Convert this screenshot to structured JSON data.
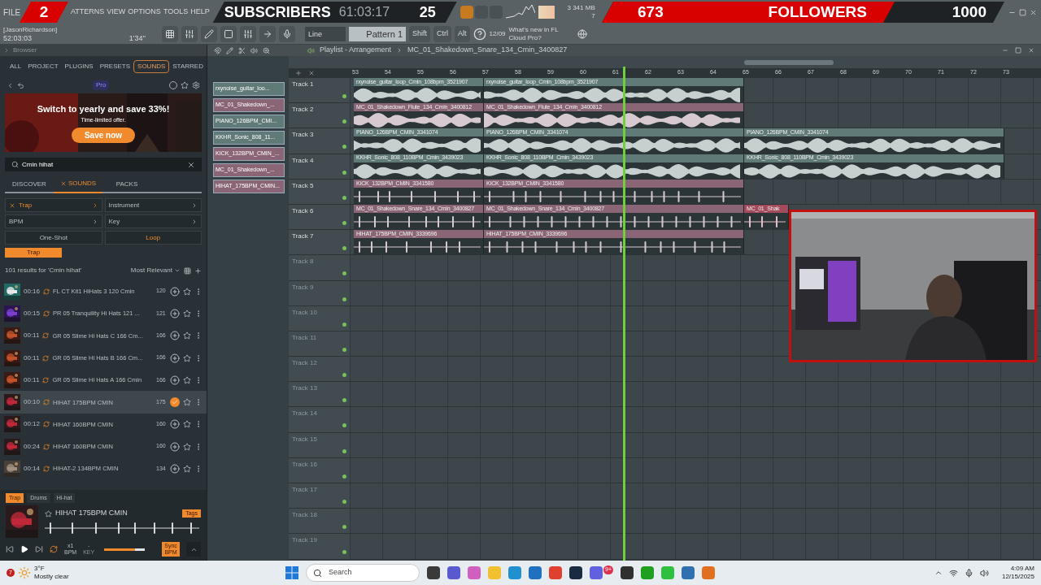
{
  "overlays": {
    "subscribers": {
      "count": "2",
      "label": "SUBSCRIBERS",
      "goal": "25"
    },
    "followers": {
      "count": "673",
      "label": "FOLLOWERS",
      "goal": "1000"
    }
  },
  "header": {
    "menu": [
      "FILE",
      "ATTERNS",
      "VIEW",
      "OPTIONS",
      "TOOLS",
      "HELP"
    ],
    "time": "61:03:17",
    "memory": "341 MB",
    "cpu": "3",
    "polyphony": "7",
    "user": "[JasonRichardson]",
    "position": "52:03:03",
    "length": "1'34''",
    "mode": "Line",
    "pattern": "Pattern 1",
    "keys": [
      "Shift",
      "Ctrl",
      "Alt"
    ],
    "news_date": "12/09",
    "news": "What's new in FL Cloud Pro?"
  },
  "browser": {
    "title": "Browser",
    "tabs": [
      {
        "label": "ALL",
        "selected": false
      },
      {
        "label": "PROJECT",
        "selected": false
      },
      {
        "label": "PLUGINS",
        "selected": false
      },
      {
        "label": "PRESETS",
        "selected": false
      },
      {
        "label": "SOUNDS",
        "selected": true
      },
      {
        "label": "STARRED",
        "selected": false
      }
    ],
    "badge": "Pro",
    "promo": {
      "title": "Switch to yearly and save 33%!",
      "subtitle": "Time-limited offer.",
      "button": "Save now"
    },
    "search": "Cmin hihat",
    "subtabs": [
      {
        "label": "DISCOVER",
        "selected": false
      },
      {
        "label": "SOUNDS",
        "selected": true
      },
      {
        "label": "PACKS",
        "selected": false
      }
    ],
    "filters": [
      {
        "kind": "dropdown",
        "label": "Trap",
        "selected": true
      },
      {
        "kind": "dropdown",
        "label": "Instrument",
        "selected": false
      },
      {
        "kind": "dropdown",
        "label": "BPM",
        "selected": false
      },
      {
        "kind": "dropdown",
        "label": "Key",
        "selected": false
      },
      {
        "kind": "toggle",
        "label": "One-Shot",
        "selected": false
      },
      {
        "kind": "toggle",
        "label": "Loop",
        "selected": true
      }
    ],
    "chips": [
      "Trap"
    ],
    "results": "101 results for 'Cmin hihat'",
    "sort": "Most Relevant",
    "rows": [
      {
        "duration": "00:16",
        "name": "FL CT Kit1 HiHats 3 120 Cmin",
        "bpm": "120",
        "selected": false
      },
      {
        "duration": "00:15",
        "name": "PR 05 Tranquility Hi Hats 121 ...",
        "bpm": "121",
        "selected": false
      },
      {
        "duration": "00:11",
        "name": "GR 05 Slime Hi Hats C 166 Cm...",
        "bpm": "166",
        "selected": false
      },
      {
        "duration": "00:11",
        "name": "GR 05 Slime Hi Hats B 166 Cm...",
        "bpm": "166",
        "selected": false
      },
      {
        "duration": "00:11",
        "name": "GR 05 Slime Hi Hats A 166 Cmin",
        "bpm": "166",
        "selected": false
      },
      {
        "duration": "00:10",
        "name": "HIHAT 175BPM CMIN",
        "bpm": "175",
        "selected": true
      },
      {
        "duration": "00:12",
        "name": "HIHAT 160BPM CMIN",
        "bpm": "160",
        "selected": false
      },
      {
        "duration": "00:24",
        "name": "HIHAT 160BPM CMIN",
        "bpm": "160",
        "selected": false
      },
      {
        "duration": "00:14",
        "name": "HIHAT-2 134BPM CMIN",
        "bpm": "134",
        "selected": false
      }
    ],
    "tags": [
      {
        "label": "Trap",
        "selected": true
      },
      {
        "label": "Drums",
        "selected": false
      },
      {
        "label": "Hi-hat",
        "selected": false
      }
    ],
    "preview": {
      "title": "HIHAT 175BPM CMIN",
      "tags_button": "Tags",
      "speed": "x1",
      "speed_unit": "BPM",
      "key": "-",
      "key_unit": "KEY",
      "sync": "Sync BPM",
      "volume": {
        "level": 0.75
      }
    }
  },
  "playlist": {
    "title": "Playlist - Arrangement",
    "pattern": "MC_01_Shakedown_Snare_134_Cmin_3400827",
    "patterns": [
      {
        "label": "rxynoise_guitar_loo...",
        "color": "#5f7a77"
      },
      {
        "label": "MC_01_Shakedown_...",
        "color": "#8a6575"
      },
      {
        "label": "PIANO_126BPM_CMI...",
        "color": "#5f7a77"
      },
      {
        "label": "KKHR_Sonic_808_11...",
        "color": "#5f7a77"
      },
      {
        "label": "KICK_132BPM_CMIN_...",
        "color": "#8a6575"
      },
      {
        "label": "MC_01_Shakedown_...",
        "color": "#8a6575"
      },
      {
        "label": "HIHAT_175BPM_CMIN...",
        "color": "#8a6575"
      }
    ],
    "ruler": [
      "53",
      "54",
      "55",
      "56",
      "57",
      "58",
      "59",
      "60",
      "61",
      "62",
      "63",
      "64",
      "65",
      "66",
      "67",
      "68",
      "69",
      "70",
      "71",
      "72",
      "73"
    ],
    "tracks": [
      {
        "name": "Track 1",
        "clips": [
          {
            "name": "rxynoise_guitar_loop_Cmin_108bpm_3521907",
            "kind": "wave",
            "color": "#5f7a77"
          },
          {
            "name": "rxynoise_guitar_loop_Cmin_108bpm_3521907",
            "kind": "wave",
            "color": "#5f7a77"
          }
        ]
      },
      {
        "name": "Track 2",
        "clips": [
          {
            "name": "MC_01_Shakedown_Flute_134_Cmin_3400812",
            "kind": "wave",
            "color": "#8a6575"
          },
          {
            "name": "MC_01_Shakedown_Flute_134_Cmin_3400812",
            "kind": "wave",
            "color": "#8a6575"
          }
        ]
      },
      {
        "name": "Track 3",
        "clips": [
          {
            "name": "PIANO_126BPM_CMIN_3341074",
            "kind": "wave",
            "color": "#5f7a77"
          },
          {
            "name": "PIANO_126BPM_CMIN_3341074",
            "kind": "wave",
            "color": "#5f7a77"
          },
          {
            "name": "PIANO_126BPM_CMIN_3341074",
            "kind": "wave",
            "color": "#5f7a77"
          }
        ]
      },
      {
        "name": "Track 4",
        "clips": [
          {
            "name": "KKHR_Sonic_808_110BPM_Cmin_3439023",
            "kind": "wave",
            "color": "#5f7a77"
          },
          {
            "name": "KKHR_Sonic_808_110BPM_Cmin_3439023",
            "kind": "wave",
            "color": "#5f7a77"
          },
          {
            "name": "KKHR_Sonic_808_110BPM_Cmin_3439023",
            "kind": "wave",
            "color": "#5f7a77"
          }
        ]
      },
      {
        "name": "Track 5",
        "clips": [
          {
            "name": "KICK_132BPM_CMIN_3341580",
            "kind": "hits",
            "color": "#8a6575"
          },
          {
            "name": "KICK_132BPM_CMIN_3341580",
            "kind": "hits",
            "color": "#8a6575"
          }
        ]
      },
      {
        "name": "Track 6",
        "clips": [
          {
            "name": "MC_01_Shakedown_Snare_134_Cmin_3400827",
            "kind": "hits",
            "color": "#8a6575"
          },
          {
            "name": "MC_01_Shakedown_Snare_134_Cmin_3400827",
            "kind": "hits",
            "color": "#8a6575"
          },
          {
            "name": "MC_01_Shak",
            "kind": "hits",
            "color": "#a34a5c"
          }
        ]
      },
      {
        "name": "Track 7",
        "clips": [
          {
            "name": "HIHAT_175BPM_CMIN_3339696",
            "kind": "hits",
            "color": "#8a6575"
          },
          {
            "name": "HIHAT_175BPM_CMIN_3339696",
            "kind": "hits",
            "color": "#8a6575"
          }
        ]
      },
      {
        "name": "Track 8"
      },
      {
        "name": "Track 9"
      },
      {
        "name": "Track 10"
      },
      {
        "name": "Track 11"
      },
      {
        "name": "Track 12"
      },
      {
        "name": "Track 13"
      },
      {
        "name": "Track 14"
      },
      {
        "name": "Track 15"
      },
      {
        "name": "Track 16"
      },
      {
        "name": "Track 17"
      },
      {
        "name": "Track 18"
      },
      {
        "name": "Track 19"
      }
    ]
  },
  "weather": {
    "temp": "3°F",
    "text": "Mostly clear",
    "badge": "7"
  },
  "taskbar": {
    "search": "Search",
    "chat_badge": "9+",
    "time": "4:09 AM",
    "date": "12/15/2025"
  }
}
